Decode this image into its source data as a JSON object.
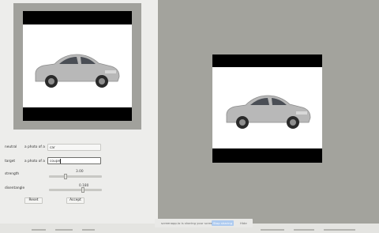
{
  "controls": {
    "neutral": {
      "label": "neutral",
      "prefix": "a photo of a",
      "value": "car"
    },
    "target": {
      "label": "target",
      "prefix": "a photo of a",
      "value": "coupe"
    },
    "strength": {
      "label": "strength",
      "value": "3.00",
      "level": 0.3
    },
    "disentangle": {
      "label": "disentangle",
      "value": "0.180",
      "level": 0.65
    },
    "reset_label": "Reset",
    "accept_label": "Accept"
  },
  "share_bar": {
    "message": "screenapp.io is sharing your screen.",
    "stop_label": "Stop sharing",
    "hide_label": "Hide"
  },
  "colors": {
    "panel_bg": "#ededeb",
    "workspace_bg": "#a3a39d",
    "stop_button": "#aecbf0"
  }
}
